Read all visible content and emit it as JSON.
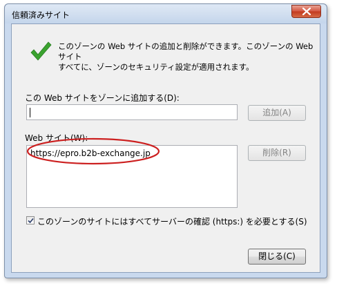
{
  "window": {
    "title": "信頼済みサイト"
  },
  "info": {
    "line1": "このゾーンの Web サイトの追加と削除ができます。このゾーンの Web サイト",
    "line2": "すべてに、ゾーンのセキュリティ設定が適用されます。"
  },
  "add_section": {
    "label": "この Web サイトをゾーンに追加する(D):",
    "input_value": "",
    "add_button": "追加(A)"
  },
  "sites_section": {
    "label": "Web サイト(W):",
    "sites": [
      "https://epro.b2b-exchange.jp"
    ],
    "remove_button": "削除(R)"
  },
  "https_checkbox": {
    "label": "このゾーンのサイトにはすべてサーバーの確認 (https:) を必要とする(S)",
    "checked": true
  },
  "close_button": "閉じる(C)",
  "colors": {
    "check_green": "#3aa32f",
    "annotation_red": "#cc1f1f",
    "close_red": "#c9452c"
  },
  "icons": {
    "info": "green-checkmark-icon",
    "close": "close-icon",
    "checkbox": "checkmark-icon"
  }
}
